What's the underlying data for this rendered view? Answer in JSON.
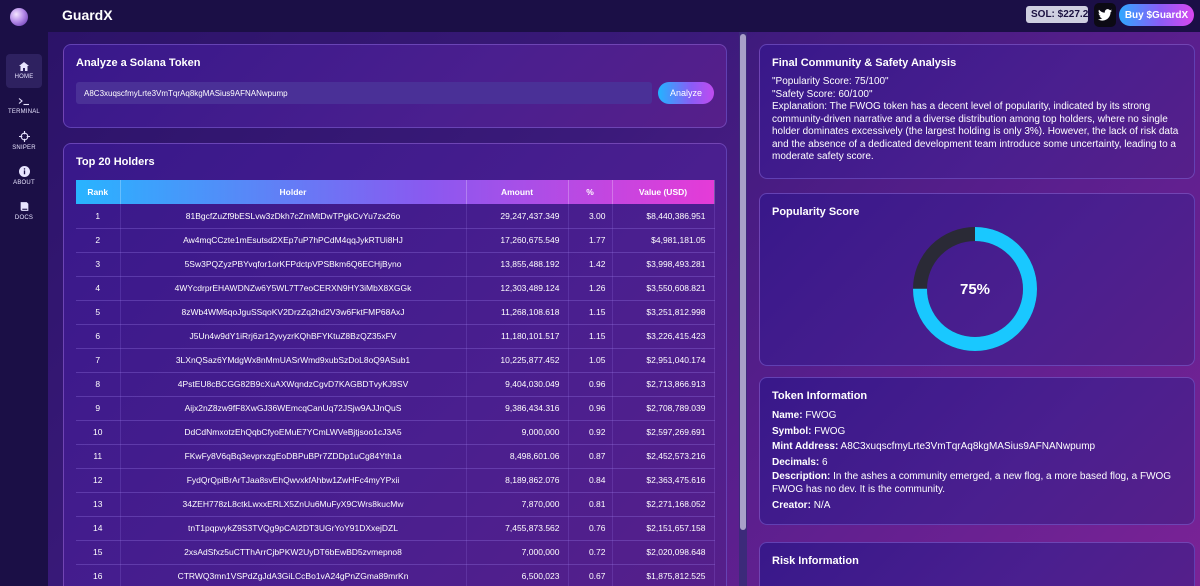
{
  "app": {
    "brand": "GuardX",
    "sol_price": "SOL: $227.29",
    "buy_label": "Buy $GuardX"
  },
  "nav": [
    {
      "label": "HOME",
      "icon": "home-icon"
    },
    {
      "label": "TERMINAL",
      "icon": "terminal-icon"
    },
    {
      "label": "SNIPER",
      "icon": "crosshair-icon"
    },
    {
      "label": "ABOUT",
      "icon": "info-icon"
    },
    {
      "label": "DOCS",
      "icon": "book-icon"
    }
  ],
  "analyze": {
    "title": "Analyze a Solana Token",
    "input_value": "A8C3xuqscfmyLrte3VmTqrAq8kgMASius9AFNANwpump",
    "button_label": "Analyze"
  },
  "holders": {
    "title": "Top 20 Holders",
    "columns": [
      "Rank",
      "Holder",
      "Amount",
      "%",
      "Value (USD)"
    ],
    "rows": [
      [
        "1",
        "81BgcfZuZf9bESLvw3zDkh7cZmMtDwTPgkCvYu7zx26o",
        "29,247,437.349",
        "3.00",
        "$8,440,386.951"
      ],
      [
        "2",
        "Aw4mqCCzte1mEsutsd2XEp7uP7hPCdM4qqJykRTUi8HJ",
        "17,260,675.549",
        "1.77",
        "$4,981,181.05"
      ],
      [
        "3",
        "5Sw3PQZyzPBYvqfor1orKFPdctpVPSBkm6Q6ECHjByno",
        "13,855,488.192",
        "1.42",
        "$3,998,493.281"
      ],
      [
        "4",
        "4WYcdrprEHAWDNZw6Y5WL7T7eoCERXN9HY3iMbX8XGGk",
        "12,303,489.124",
        "1.26",
        "$3,550,608.821"
      ],
      [
        "5",
        "8zWb4WM6qoJguSSqoKV2DrzZq2hd2V3w6FktFMP68AxJ",
        "11,268,108.618",
        "1.15",
        "$3,251,812.998"
      ],
      [
        "6",
        "J5Un4w9dY1iRrj6zr12yvyzrKQhBFYKtuZ8BzQZ35xFV",
        "11,180,101.517",
        "1.15",
        "$3,226,415.423"
      ],
      [
        "7",
        "3LXnQSaz6YMdgWx8nMmUASrWmd9xubSzDoL8oQ9ASub1",
        "10,225,877.452",
        "1.05",
        "$2,951,040.174"
      ],
      [
        "8",
        "4PstEU8cBCGG82B9cXuAXWqndzCgvD7KAGBDTvyKJ9SV",
        "9,404,030.049",
        "0.96",
        "$2,713,866.913"
      ],
      [
        "9",
        "Aijx2nZ8zw9fF8XwGJ36WEmcqCanUq72JSjw9AJJnQuS",
        "9,386,434.316",
        "0.96",
        "$2,708,789.039"
      ],
      [
        "10",
        "DdCdNmxotzEhQqbCfyoEMuE7YCmLWVeBjtjsoo1cJ3A5",
        "9,000,000",
        "0.92",
        "$2,597,269.691"
      ],
      [
        "11",
        "FKwFy8V6qBq3evprxzgEoDBPuBPr7ZDDp1uCg84Yth1a",
        "8,498,601.06",
        "0.87",
        "$2,452,573.216"
      ],
      [
        "12",
        "FydQrQpiBrArTJaa8svEhQwvxkfAhbw1ZwHFc4myYPxii",
        "8,189,862.076",
        "0.84",
        "$2,363,475.616"
      ],
      [
        "13",
        "34ZEH778zL8ctkLwxxERLX5ZnUu6MuFyX9CWrs8kucMw",
        "7,870,000",
        "0.81",
        "$2,271,168.052"
      ],
      [
        "14",
        "tnT1pqpvykZ9S3TVQg9pCAI2DT3UGrYoY91DXxejDZL",
        "7,455,873.562",
        "0.76",
        "$2,151,657.158"
      ],
      [
        "15",
        "2xsAdSfxz5uCTThArrCjbPKW2UyDT6bEwBD5zvmepno8",
        "7,000,000",
        "0.72",
        "$2,020,098.648"
      ],
      [
        "16",
        "CTRWQ3mn1VSPdZgJdA3GiLCcBo1vA24gPnZGma89mrKn",
        "6,500,023",
        "0.67",
        "$1,875,812.525"
      ]
    ]
  },
  "analysis": {
    "title": "Final Community & Safety Analysis",
    "popularity_line": "\"Popularity Score: 75/100\"",
    "safety_line": "\"Safety Score: 60/100\"",
    "explanation": "Explanation: The FWOG token has a decent level of popularity, indicated by its strong community-driven narrative and a diverse distribution among top holders, where no single holder dominates excessively (the largest holding is only 3%). However, the lack of risk data and the absence of a dedicated development team introduce some uncertainty, leading to a moderate safety score."
  },
  "popularity": {
    "title": "Popularity Score",
    "value_label": "75%",
    "fraction": 0.75,
    "ring_color": "#19c8ff",
    "track_color": "#2a2a36"
  },
  "token": {
    "title": "Token Information",
    "name_label": "Name:",
    "name": "FWOG",
    "symbol_label": "Symbol:",
    "symbol": "FWOG",
    "mint_label": "Mint Address:",
    "mint": "A8C3xuqscfmyLrte3VmTqrAq8kgMASius9AFNANwpump",
    "decimals_label": "Decimals:",
    "decimals": "6",
    "description_label": "Description:",
    "description": "In the ashes a community emerged, a new flog, a more based flog, a FWOG FWOG has no dev. It is the community.",
    "creator_label": "Creator:",
    "creator": "N/A"
  },
  "risk": {
    "title": "Risk Information"
  }
}
